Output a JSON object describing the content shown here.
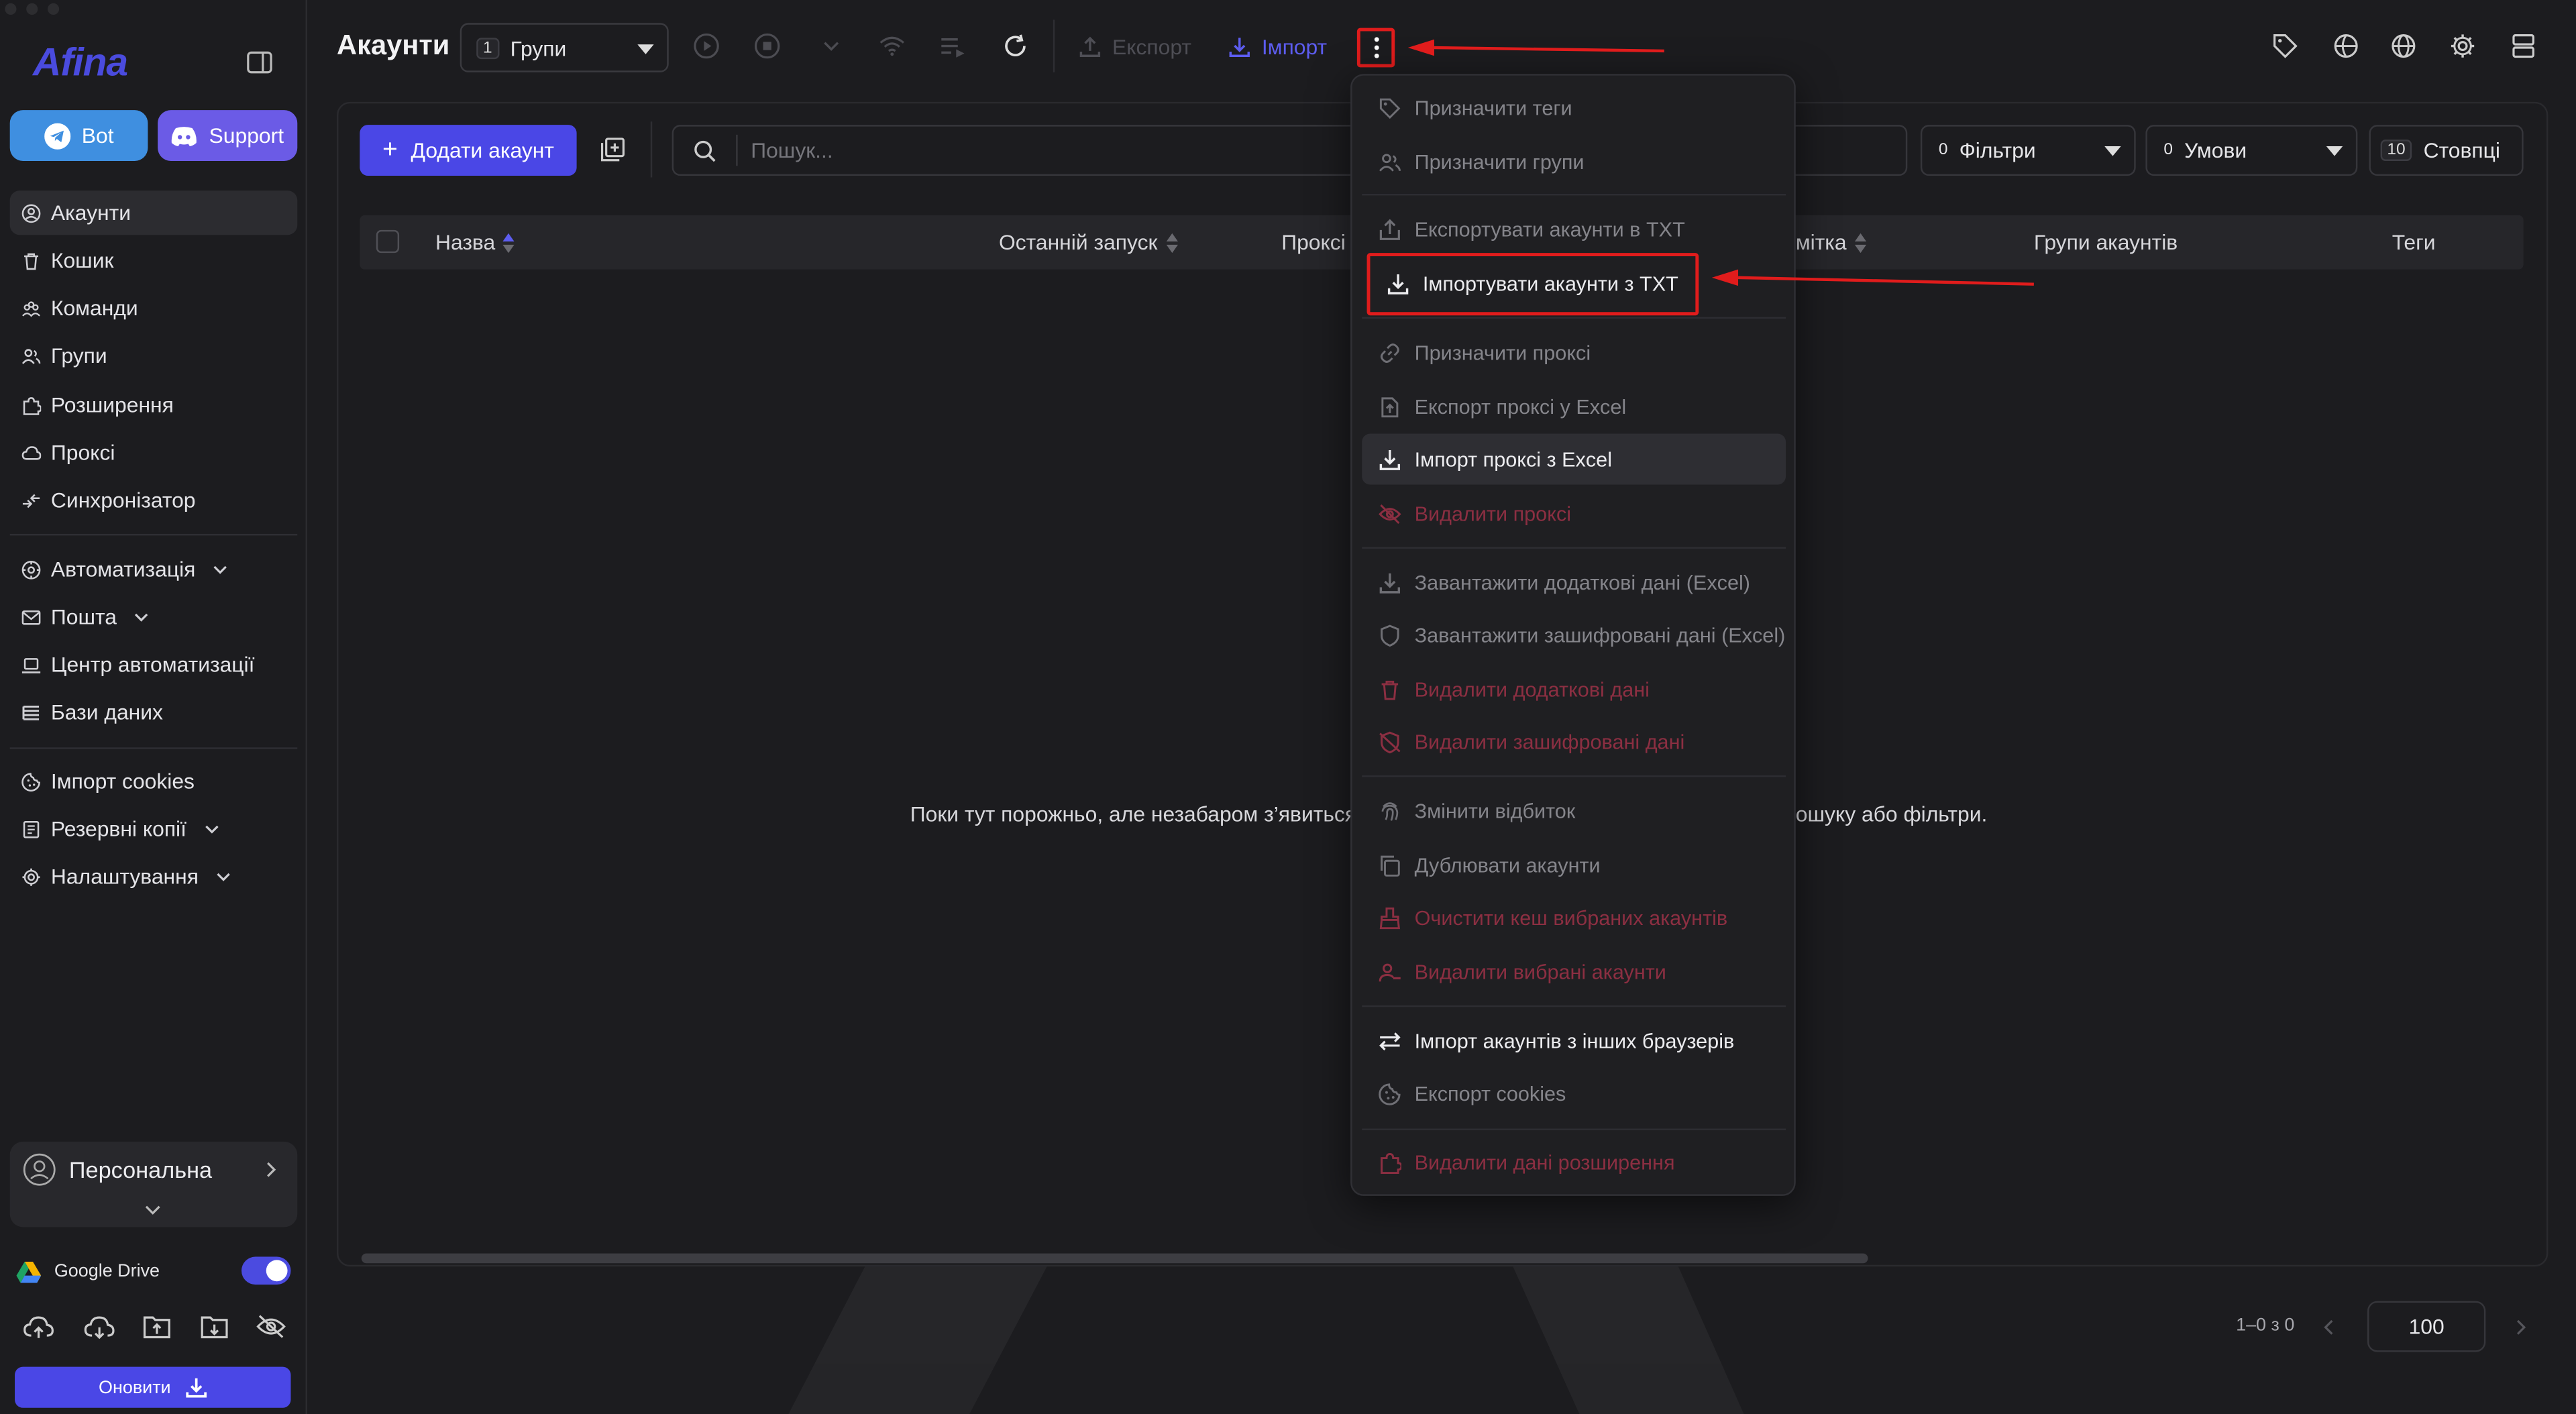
{
  "app": {
    "name": "Afina",
    "page_title": "Акаунти"
  },
  "sidebar": {
    "bot_label": "Bot",
    "support_label": "Support",
    "nav": [
      {
        "label": "Акаунти",
        "icon": "user-circle-icon",
        "active": true
      },
      {
        "label": "Кошик",
        "icon": "trash-icon"
      },
      {
        "label": "Команди",
        "icon": "team-icon"
      },
      {
        "label": "Групи",
        "icon": "group-icon"
      },
      {
        "label": "Розширення",
        "icon": "puzzle-icon"
      },
      {
        "label": "Проксі",
        "icon": "cloud-icon"
      },
      {
        "label": "Синхронізатор",
        "icon": "sync-icon"
      }
    ],
    "nav2": [
      {
        "label": "Автоматизація",
        "icon": "automation-icon",
        "expandable": true
      },
      {
        "label": "Пошта",
        "icon": "mail-icon",
        "expandable": true
      },
      {
        "label": "Центр автоматизації",
        "icon": "laptop-icon"
      },
      {
        "label": "Бази даних",
        "icon": "database-icon"
      }
    ],
    "nav3": [
      {
        "label": "Імпорт cookies",
        "icon": "cookie-icon"
      },
      {
        "label": "Резервні копії",
        "icon": "backup-icon",
        "expandable": true
      },
      {
        "label": "Налаштування",
        "icon": "gear-icon",
        "expandable": true
      }
    ],
    "workspace": "Персональна",
    "gdrive_label": "Google Drive",
    "gdrive_enabled": true,
    "update_label": "Оновити"
  },
  "toolbar": {
    "groups_count": "1",
    "groups_label": "Групи",
    "export_label": "Експорт",
    "import_label": "Імпорт"
  },
  "main": {
    "add_account_label": "Додати акаунт",
    "search_placeholder": "Пошук...",
    "filters_count": "0",
    "filters_label": "Фільтри",
    "conditions_count": "0",
    "conditions_label": "Умови",
    "columns_count": "10",
    "columns_label": "Стовпці",
    "columns": [
      "Назва",
      "Останній запуск",
      "Проксі",
      "Примітка",
      "Групи акаунтів",
      "Теги"
    ],
    "column_visible_notes": "мітка",
    "empty_left": "Поки тут порожньо, але незабаром з’явиться в",
    "empty_right": "ошуку або фільтри.",
    "pagination": "1–0 з 0",
    "page_size": "100"
  },
  "menu": {
    "items": [
      {
        "label": "Призначити теги",
        "icon": "tag-icon",
        "state": "disabled"
      },
      {
        "label": "Призначити групи",
        "icon": "group-icon",
        "state": "disabled"
      },
      {
        "label": "Експортувати акаунти в TXT",
        "icon": "upload-icon",
        "state": "disabled"
      },
      {
        "label": "Імпортувати акаунти з TXT",
        "icon": "download-icon",
        "state": "highlight"
      },
      {
        "label": "Призначити проксі",
        "icon": "link-icon",
        "state": "disabled"
      },
      {
        "label": "Експорт проксі у Excel",
        "icon": "file-export-icon",
        "state": "disabled"
      },
      {
        "label": "Імпорт проксі з Excel",
        "icon": "download-icon",
        "state": "hover"
      },
      {
        "label": "Видалити проксі",
        "icon": "eye-off-icon",
        "state": "danger"
      },
      {
        "label": "Завантажити додаткові дані (Excel)",
        "icon": "download-icon",
        "state": "disabled"
      },
      {
        "label": "Завантажити зашифровані дані (Excel)",
        "icon": "shield-icon",
        "state": "disabled"
      },
      {
        "label": "Видалити додаткові дані",
        "icon": "trash-icon",
        "state": "danger"
      },
      {
        "label": "Видалити зашифровані дані",
        "icon": "shield-off-icon",
        "state": "danger"
      },
      {
        "label": "Змінити відбиток",
        "icon": "fingerprint-icon",
        "state": "disabled"
      },
      {
        "label": "Дублювати акаунти",
        "icon": "copy-icon",
        "state": "disabled"
      },
      {
        "label": "Очистити кеш вибраних акаунтів",
        "icon": "brush-icon",
        "state": "danger"
      },
      {
        "label": "Видалити вибрані акаунти",
        "icon": "user-remove-icon",
        "state": "danger"
      },
      {
        "label": "Імпорт акаунтів з інших браузерів",
        "icon": "swap-icon",
        "state": "bright"
      },
      {
        "label": "Експорт cookies",
        "icon": "cookie-icon",
        "state": "disabled"
      },
      {
        "label": "Видалити дані розширення",
        "icon": "puzzle-icon",
        "state": "danger"
      }
    ]
  },
  "colors": {
    "accent": "#4a47e6",
    "annotation": "#e01c1c",
    "danger": "#8c2f42"
  }
}
